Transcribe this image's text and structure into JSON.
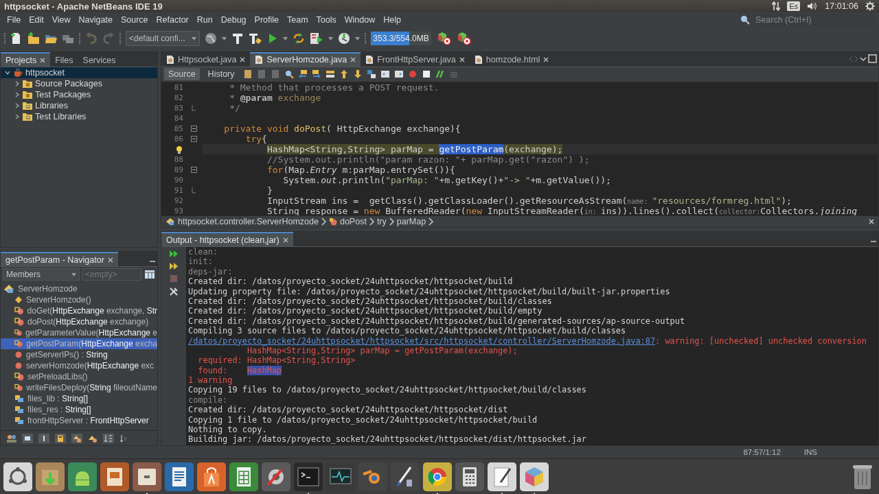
{
  "system_bar": {
    "title": "httpsocket - Apache NetBeans IDE 19",
    "keyboard": "Es",
    "clock": "17:01:06"
  },
  "menu": [
    "File",
    "Edit",
    "View",
    "Navigate",
    "Source",
    "Refactor",
    "Run",
    "Debug",
    "Profile",
    "Team",
    "Tools",
    "Window",
    "Help"
  ],
  "search": {
    "placeholder": "Search (Ctrl+I)"
  },
  "toolbar": {
    "config": "<default confi...",
    "memory": {
      "reading": "353.3/554.0MB",
      "level": 0.64
    }
  },
  "left_tabs": [
    {
      "label": "Projects",
      "selected": true
    },
    {
      "label": "Files",
      "selected": false
    },
    {
      "label": "Services",
      "selected": false
    }
  ],
  "project_tree": {
    "label": "httpsocket",
    "selected": true,
    "expanded": true,
    "children": [
      {
        "label": "Source Packages",
        "kind": "package",
        "expanded": false
      },
      {
        "label": "Test Packages",
        "kind": "package",
        "expanded": false
      },
      {
        "label": "Libraries",
        "kind": "library",
        "expanded": false
      },
      {
        "label": "Test Libraries",
        "kind": "library",
        "expanded": false
      }
    ]
  },
  "editor_tabs": [
    {
      "label": "Httpsocket.java",
      "selected": false
    },
    {
      "label": "ServerHomzode.java",
      "selected": true
    },
    {
      "label": "FrontHttpServer.java",
      "selected": false
    },
    {
      "label": "homzode.html",
      "selected": false
    }
  ],
  "editor_views": [
    {
      "label": "Source",
      "selected": true
    },
    {
      "label": "History",
      "selected": false
    }
  ],
  "code": [
    {
      "line": "81",
      "foldable": false,
      "block_end": false,
      "segments": [
        {
          "kind": "comment",
          "text": "     * Method that processes a POST request."
        }
      ]
    },
    {
      "line": "82",
      "foldable": false,
      "block_end": false,
      "segments": [
        {
          "kind": "comment",
          "text": "     * "
        },
        {
          "kind": "comment-tag",
          "text": "@param"
        },
        {
          "kind": "comment-param",
          "text": " exchange"
        }
      ]
    },
    {
      "line": "83",
      "foldable": false,
      "block_end": true,
      "segments": [
        {
          "kind": "comment",
          "text": "     */"
        }
      ]
    },
    {
      "line": "84",
      "foldable": false,
      "block_end": false
    },
    {
      "line": "85",
      "foldable": true,
      "block_end": false,
      "segments": [
        {
          "kind": "keyword",
          "text": "    private void "
        },
        {
          "kind": "method",
          "text": "doPost"
        },
        {
          "kind": "plain",
          "text": "( HttpExchange exchange){"
        }
      ]
    },
    {
      "line": "86",
      "foldable": true,
      "block_end": false,
      "segments": [
        {
          "kind": "keyword",
          "text": "        try"
        },
        {
          "kind": "plain",
          "text": "{"
        }
      ]
    },
    {
      "hint": true,
      "current": true,
      "foldable": false,
      "block_end": false,
      "segments": [
        {
          "kind": "match",
          "text": "            HashMap<String,String> parMap = "
        },
        {
          "kind": "selection",
          "text": "getPostParam"
        },
        {
          "kind": "match",
          "text": "(exchange);"
        }
      ]
    },
    {
      "line": "88",
      "foldable": false,
      "block_end": false,
      "segments": [
        {
          "kind": "comment",
          "text": "            //System.out.println(\"param razon: \"+ parMap.get(\"razon\") );"
        }
      ]
    },
    {
      "line": "89",
      "foldable": true,
      "block_end": false,
      "segments": [
        {
          "kind": "keyword",
          "text": "            for"
        },
        {
          "kind": "plain",
          "text": "(Map."
        },
        {
          "kind": "static",
          "text": "Entry"
        },
        {
          "kind": "plain",
          "text": " m:parMap.entrySet()){"
        }
      ]
    },
    {
      "line": "90",
      "foldable": false,
      "block_end": false,
      "segments": [
        {
          "kind": "plain",
          "text": "               System."
        },
        {
          "kind": "static",
          "text": "out"
        },
        {
          "kind": "plain",
          "text": ".println("
        },
        {
          "kind": "string",
          "text": "\"parMap: \""
        },
        {
          "kind": "plain",
          "text": "+m.getKey()+"
        },
        {
          "kind": "string",
          "text": "\"-> \""
        },
        {
          "kind": "plain",
          "text": "+m.getValue());"
        }
      ]
    },
    {
      "line": "91",
      "foldable": false,
      "block_end": true,
      "segments": [
        {
          "kind": "plain",
          "text": "            }"
        }
      ]
    },
    {
      "line": "92",
      "foldable": false,
      "block_end": false,
      "segments": [
        {
          "kind": "plain",
          "text": "            InputStream ins =  getClass().getClassLoader().getResourceAsStream("
        },
        {
          "kind": "hint",
          "text": "name: "
        },
        {
          "kind": "string",
          "text": "\"resources/formreg.html\""
        },
        {
          "kind": "plain",
          "text": ");"
        }
      ]
    },
    {
      "line": "93",
      "foldable": false,
      "block_end": false,
      "segments": [
        {
          "kind": "plain",
          "text": "            String response = "
        },
        {
          "kind": "keyword",
          "text": "new "
        },
        {
          "kind": "plain",
          "text": "BufferedReader("
        },
        {
          "kind": "keyword",
          "text": "new "
        },
        {
          "kind": "plain",
          "text": "InputStreamReader("
        },
        {
          "kind": "hint",
          "text": "in: "
        },
        {
          "kind": "plain",
          "text": "ins)).lines().collect("
        },
        {
          "kind": "hint",
          "text": "collector:"
        },
        {
          "kind": "plain",
          "text": "Collectors."
        },
        {
          "kind": "static",
          "text": "joining"
        }
      ]
    }
  ],
  "breadcrumb": [
    "httpsocket.controller.ServerHomzode",
    "doPost",
    "try",
    "parMap"
  ],
  "output": {
    "title": "Output - httpsocket (clean,jar)",
    "lines": [
      {
        "segments": [
          {
            "kind": "target",
            "text": "clean:"
          }
        ]
      },
      {
        "segments": [
          {
            "kind": "target",
            "text": "init:"
          }
        ]
      },
      {
        "segments": [
          {
            "kind": "target",
            "text": "deps-jar:"
          }
        ]
      },
      {
        "segments": [
          {
            "kind": "text",
            "text": "Created dir: /datos/proyecto_socket/24uhttpsocket/httpsocket/build"
          }
        ]
      },
      {
        "segments": [
          {
            "kind": "text",
            "text": "Updating property file: /datos/proyecto_socket/24uhttpsocket/httpsocket/build/built-jar.properties"
          }
        ]
      },
      {
        "segments": [
          {
            "kind": "text",
            "text": "Created dir: /datos/proyecto_socket/24uhttpsocket/httpsocket/build/classes"
          }
        ]
      },
      {
        "segments": [
          {
            "kind": "text",
            "text": "Created dir: /datos/proyecto_socket/24uhttpsocket/httpsocket/build/empty"
          }
        ]
      },
      {
        "segments": [
          {
            "kind": "text",
            "text": "Created dir: /datos/proyecto_socket/24uhttpsocket/httpsocket/build/generated-sources/ap-source-output"
          }
        ]
      },
      {
        "segments": [
          {
            "kind": "text",
            "text": "Compiling 3 source files to /datos/proyecto_socket/24uhttpsocket/httpsocket/build/classes"
          }
        ]
      },
      {
        "segments": [
          {
            "kind": "link",
            "text": "/datos/proyecto_socket/24uhttpsocket/httpsocket/src/httpsocket/controller/ServerHomzode.java:87"
          },
          {
            "kind": "error",
            "text": ": warning: [unchecked] unchecked conversion"
          }
        ]
      },
      {
        "segments": [
          {
            "kind": "error",
            "text": "            HashMap<String,String> parMap = getPostParam(exchange);"
          }
        ]
      },
      {
        "segments": [
          {
            "kind": "error",
            "text": "  required: HashMap<String,String>"
          }
        ]
      },
      {
        "segments": [
          {
            "kind": "error",
            "text": "  found:    "
          },
          {
            "kind": "error-highlight",
            "text": "HashMap"
          }
        ]
      },
      {
        "segments": [
          {
            "kind": "error",
            "text": "1 warning"
          }
        ]
      },
      {
        "segments": [
          {
            "kind": "text",
            "text": "Copying 19 files to /datos/proyecto_socket/24uhttpsocket/httpsocket/build/classes"
          }
        ]
      },
      {
        "segments": [
          {
            "kind": "target",
            "text": "compile:"
          }
        ]
      },
      {
        "segments": [
          {
            "kind": "text",
            "text": "Created dir: /datos/proyecto_socket/24uhttpsocket/httpsocket/dist"
          }
        ]
      },
      {
        "segments": [
          {
            "kind": "text",
            "text": "Copying 1 file to /datos/proyecto_socket/24uhttpsocket/httpsocket/build"
          }
        ]
      },
      {
        "segments": [
          {
            "kind": "text",
            "text": "Nothing to copy."
          }
        ]
      },
      {
        "segments": [
          {
            "kind": "text",
            "text": "Building jar: /datos/proyecto_socket/24uhttpsocket/httpsocket/dist/httpsocket.jar"
          }
        ]
      }
    ]
  },
  "navigator": {
    "title": "getPostParam - Navigator",
    "filter": "Members",
    "search_placeholder": "<empty>",
    "root": "ServerHomzode",
    "items": [
      {
        "kind": "constructor",
        "text": "ServerHomzode()",
        "selected": false
      },
      {
        "kind": "protected",
        "text": "doGet(**HttpExchange** exchange, **Str**",
        "selected": false
      },
      {
        "kind": "protected",
        "text": "doPost(**HttpExchange** exchange)",
        "selected": false
      },
      {
        "kind": "protected",
        "text": "getParameterValue(**HttpExchange** e",
        "selected": false
      },
      {
        "kind": "protected",
        "text": "getPostParam(**HttpExchange** excha",
        "selected": true
      },
      {
        "kind": "private",
        "text": "getServerIPs() : **String**",
        "selected": false
      },
      {
        "kind": "private",
        "text": "serverHomzode(**HttpExchange** exc",
        "selected": false
      },
      {
        "kind": "protected",
        "text": "setPreloadLibs()",
        "selected": false
      },
      {
        "kind": "protected",
        "text": "writeFilesDeploy(**String** fileoutName",
        "selected": false
      },
      {
        "kind": "field",
        "text": "files_lib : **String[]**",
        "selected": false
      },
      {
        "kind": "field",
        "text": "files_res : **String[]**",
        "selected": false
      },
      {
        "kind": "field",
        "text": "frontHttpServer : **FrontHttpServer**",
        "selected": false
      }
    ]
  },
  "status": {
    "position": "87:57/1:12",
    "mode": "INS"
  },
  "dock": [
    {
      "running": false
    },
    {
      "running": false
    },
    {
      "running": false
    },
    {
      "running": false
    },
    {
      "running": true
    },
    {
      "running": false
    },
    {
      "running": false
    },
    {
      "running": false
    },
    {
      "running": false
    },
    {
      "running": true
    },
    {
      "running": false
    },
    {
      "running": false
    },
    {
      "running": false
    },
    {
      "running": true
    },
    {
      "running": false
    },
    {
      "running": true
    },
    {
      "running": true
    }
  ]
}
